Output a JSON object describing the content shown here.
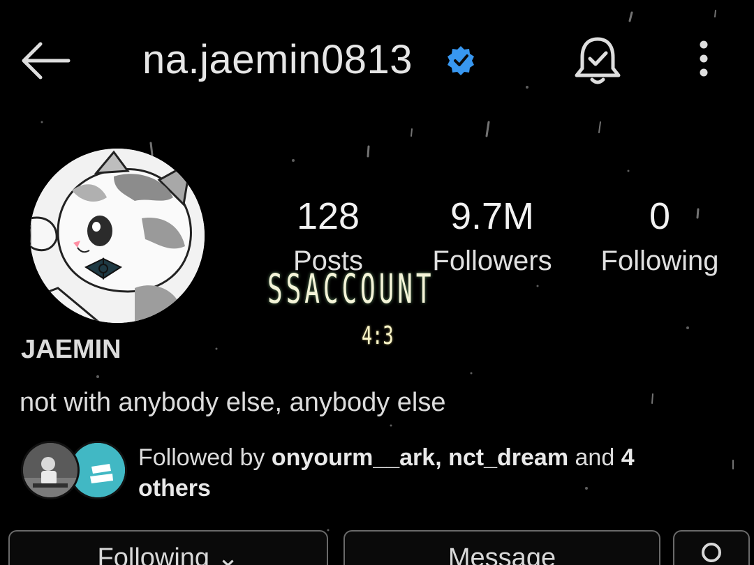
{
  "header": {
    "username": "na.jaemin0813",
    "verified": true,
    "back_icon": "arrow-left-icon",
    "bell_icon": "bell-check-icon",
    "more_icon": "more-vertical-icon"
  },
  "profile": {
    "display_name": "JAEMIN",
    "bio": "not with anybody else, anybody else",
    "avatar": "cartoon-cat-avatar"
  },
  "stats": {
    "posts": {
      "value": "128",
      "label": "Posts"
    },
    "followers": {
      "value": "9.7M",
      "label": "Followers"
    },
    "following": {
      "value": "0",
      "label": "Following"
    }
  },
  "overlay": {
    "title": "SSACCOUNT",
    "ratio": "4:3"
  },
  "followed_by": {
    "prefix": "Followed by ",
    "user1": "onyourm__ark",
    "sep": ", ",
    "user2": "nct_dream",
    "and": " and ",
    "count": "4",
    "suffix": " others"
  },
  "actions": {
    "following_label": "Following ⌄",
    "message_label": "Message",
    "adduser_icon": "add-person-icon"
  },
  "colors": {
    "background": "#000000",
    "verified_badge": "#3897f0",
    "text": "#e6e6e6",
    "overlay_title": "#f4f4d8"
  }
}
